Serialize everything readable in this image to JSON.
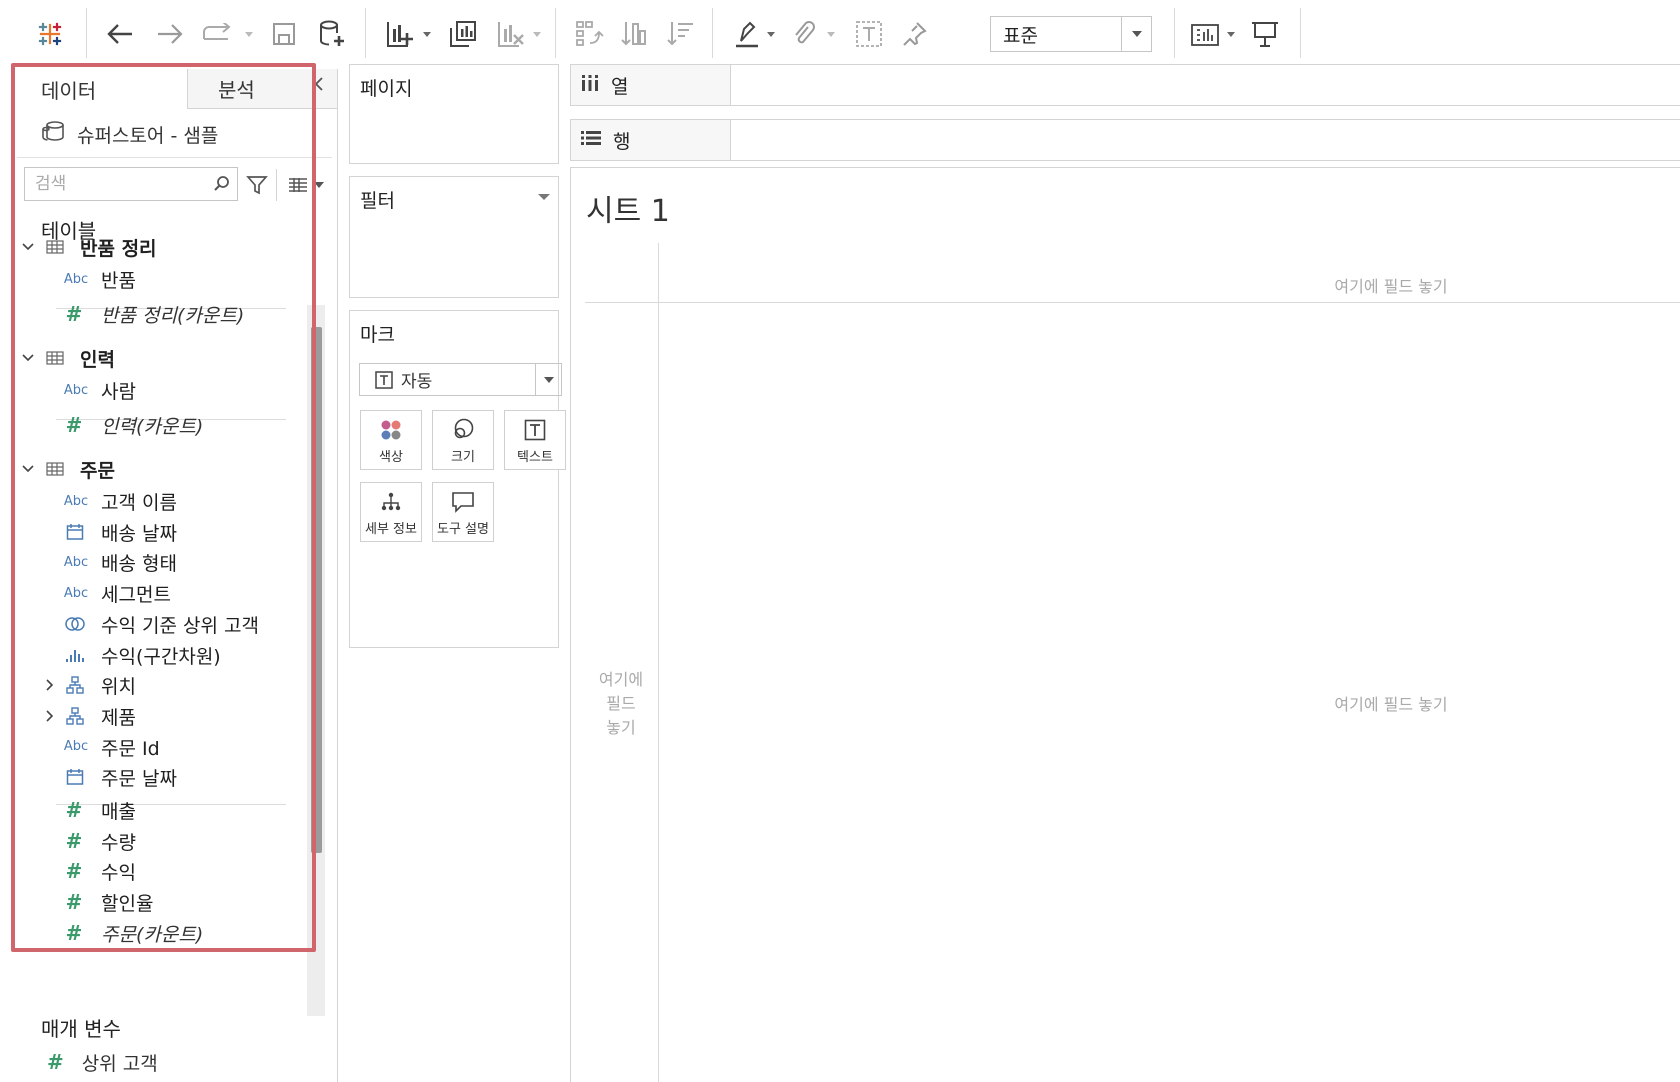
{
  "toolbar": {
    "icons": [
      "tableau-logo-icon",
      "undo-icon",
      "redo-icon",
      "replay-icon",
      "save-icon",
      "new-datasource-icon",
      "new-worksheet-icon",
      "duplicate-sheet-icon",
      "clear-sheet-icon",
      "swap-icon",
      "sort-ascending-icon",
      "sort-descending-icon",
      "highlight-icon",
      "group-icon",
      "show-labels-icon",
      "pin-icon",
      "show-me-icon",
      "presentation-icon"
    ],
    "fit_value": "표준"
  },
  "data_pane": {
    "tab_data": "데이터",
    "tab_analysis": "분석",
    "datasource": "슈퍼스토어 - 샘플",
    "search_placeholder": "검색",
    "tables_title": "테이블",
    "tables": [
      {
        "name": "반품 정리",
        "fields": [
          {
            "type": "abc",
            "type_label": "Abc",
            "name": "반품"
          },
          {
            "type": "measure",
            "type_label": "#",
            "name": "반품 정리(카운트)",
            "italic": true
          }
        ]
      },
      {
        "name": "인력",
        "fields": [
          {
            "type": "abc",
            "type_label": "Abc",
            "name": "사람"
          },
          {
            "type": "measure",
            "type_label": "#",
            "name": "인력(카운트)",
            "italic": true
          }
        ]
      },
      {
        "name": "주문",
        "fields": [
          {
            "type": "abc",
            "type_label": "Abc",
            "name": "고객 이름"
          },
          {
            "type": "date",
            "name": "배송 날짜"
          },
          {
            "type": "abc",
            "type_label": "Abc",
            "name": "배송 형태"
          },
          {
            "type": "abc",
            "type_label": "Abc",
            "name": "세그먼트"
          },
          {
            "type": "set",
            "name": "수익 기준 상위 고객"
          },
          {
            "type": "bin",
            "name": "수익(구간차원)"
          },
          {
            "type": "hierarchy",
            "name": "위치"
          },
          {
            "type": "hierarchy",
            "name": "제품"
          },
          {
            "type": "abc",
            "type_label": "Abc",
            "name": "주문 Id"
          },
          {
            "type": "date",
            "name": "주문 날짜"
          },
          {
            "type": "measure",
            "type_label": "#",
            "name": "매출"
          },
          {
            "type": "measure",
            "type_label": "#",
            "name": "수량"
          },
          {
            "type": "measure",
            "type_label": "#",
            "name": "수익"
          },
          {
            "type": "measure",
            "type_label": "#",
            "name": "할인율"
          },
          {
            "type": "measure",
            "type_label": "#",
            "name": "주문(카운트)",
            "italic": true
          }
        ]
      }
    ],
    "params_title": "매개 변수",
    "params": [
      {
        "type_label": "#",
        "name": "상위 고객"
      }
    ]
  },
  "cards": {
    "pages": "페이지",
    "filters": "필터",
    "marks": "마크",
    "marks_type": "자동",
    "mark_buttons": {
      "color": "색상",
      "size": "크기",
      "text": "텍스트",
      "detail": "세부 정보",
      "tooltip": "도구 설명"
    }
  },
  "shelves": {
    "columns": "열",
    "rows": "행"
  },
  "sheet": {
    "title": "시트 1",
    "drop_top": "여기에 필드 놓기",
    "drop_left": "여기에\n필드\n놓기",
    "drop_center": "여기에 필드 놓기"
  },
  "colors": {
    "highlight_border": "#d0656b",
    "measure_green": "#3a9a6b",
    "dimension_blue": "#4a7bb5"
  }
}
